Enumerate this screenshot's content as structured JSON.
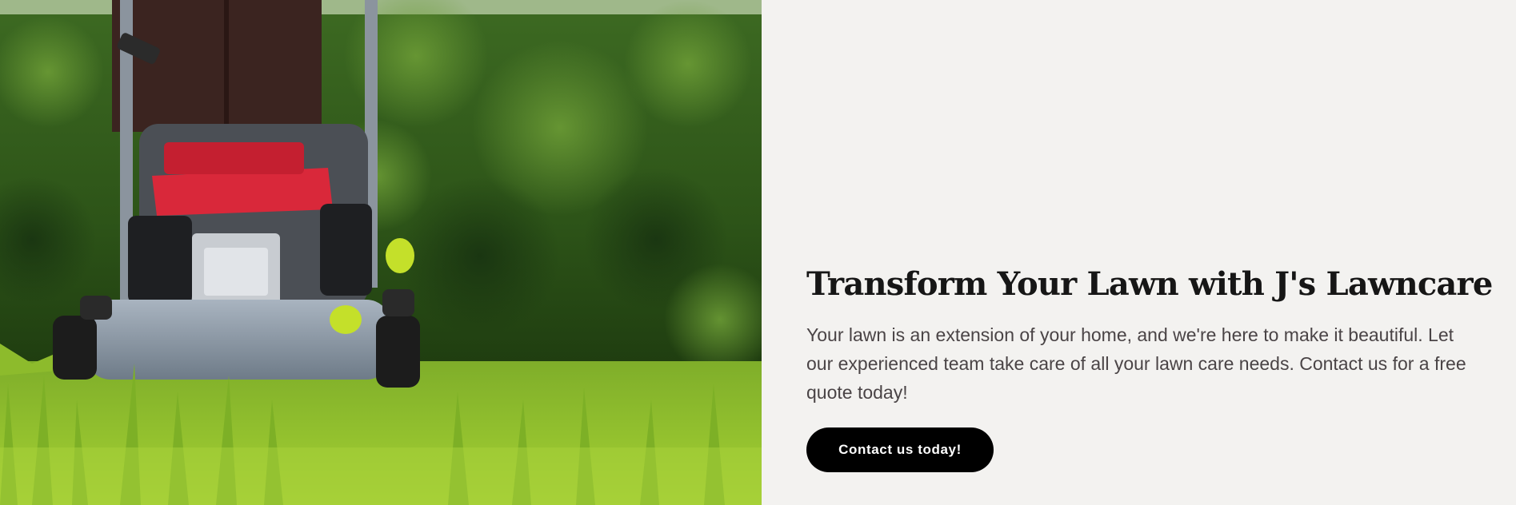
{
  "hero": {
    "image_alt": "lawn-mower-photo",
    "headline": "Transform Your Lawn with J's Lawncare",
    "body": "Your lawn is an extension of your home, and we're here to make it beautiful. Let our experienced team take care of all your lawn care needs. Contact us for a free quote today!",
    "cta_label": "Contact us today!"
  },
  "colors": {
    "background": "#f3f2f0",
    "headline": "#161616",
    "body": "#4a4446",
    "button": "#000000",
    "button_text": "#ffffff"
  }
}
